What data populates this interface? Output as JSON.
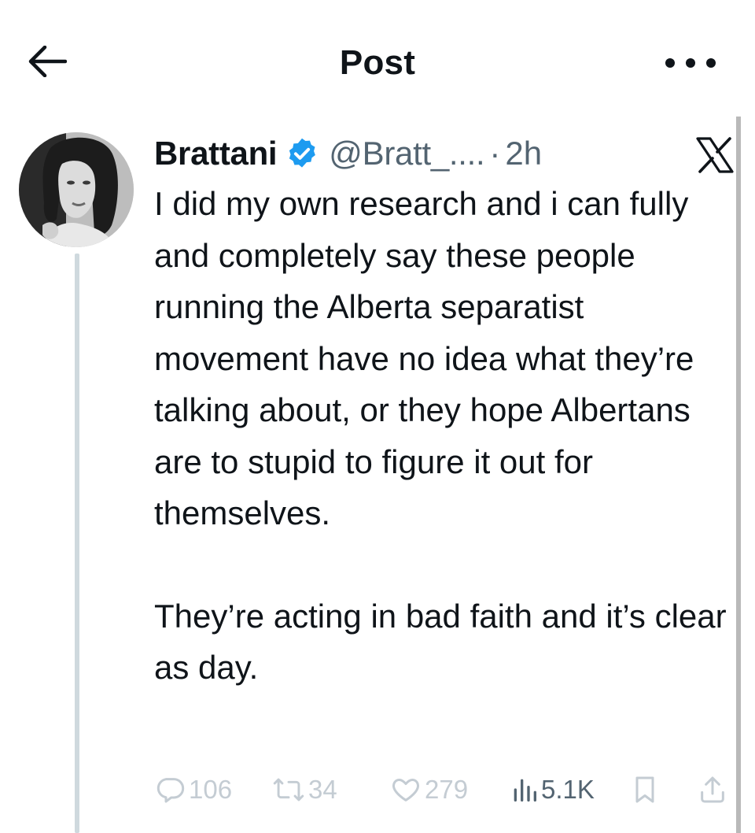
{
  "header": {
    "title": "Post"
  },
  "post": {
    "author": {
      "display_name": "Brattani",
      "handle": "@Bratt_....",
      "verified": true
    },
    "separator": "·",
    "time": "2h",
    "paragraphs": [
      "I did my own research and i can fully and completely say these people running the Alberta separatist movement have no idea what they’re talking about, or they hope Albertans are to stupid to figure it out for themselves.",
      "They’re acting in bad faith and it’s clear as day."
    ],
    "metrics": {
      "replies": "106",
      "reposts": "34",
      "likes": "279",
      "views": "5.1K"
    }
  },
  "icons": {
    "back": "arrow-left-icon",
    "more": "more-horizontal-icon",
    "verified": "verified-badge-icon",
    "brand": "x-logo-icon",
    "reply": "reply-icon",
    "repost": "repost-icon",
    "like": "heart-icon",
    "views": "views-icon",
    "bookmark": "bookmark-icon",
    "share": "share-icon"
  },
  "colors": {
    "verified": "#1d9bf0",
    "text": "#0f1419",
    "secondary": "#536471"
  }
}
